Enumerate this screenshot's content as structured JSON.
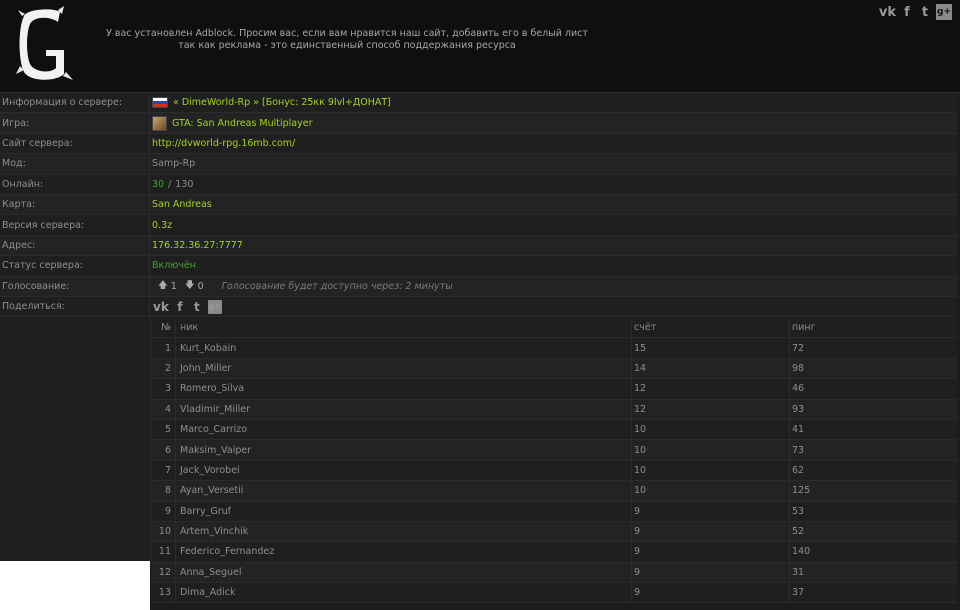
{
  "header": {
    "adblock_line1": "У вас установлен Adblock. Просим вас, если вам нравится наш сайт, добавить его в белый лист",
    "adblock_line2": "так как реклама - это единственный способ поддержания ресурса",
    "social": {
      "vk": "vk",
      "facebook": "f",
      "twitter": "t",
      "googleplus": "g+"
    }
  },
  "server_info": {
    "server_label": "Информация о сервере:",
    "server_name": "« DimeWorld-Rp » [Бонус: 25кк 9lvl+ДОНАТ]",
    "game_label": "Игра:",
    "game_value": "GTA: San Andreas Multiplayer",
    "site_label": "Сайт сервера:",
    "site_value": "http://dvworld-rpg.16mb.com/",
    "mod_label": "Мод:",
    "mod_value": "Samp-Rp",
    "online_label": "Онлайн:",
    "online_current": "30",
    "online_sep": "/",
    "online_max": "130",
    "map_label": "Карта:",
    "map_value": "San Andreas",
    "version_label": "Версия сервера:",
    "version_value": "0.3z",
    "address_label": "Адрес:",
    "address_value": "176.32.36.27:7777",
    "status_label": "Статус сервера:",
    "status_value": "Включён",
    "vote_label": "Голосование:",
    "vote_up": "1",
    "vote_down": "0",
    "vote_note": "Голосование будет доступно через: 2 минуты",
    "share_label": "Поделиться:"
  },
  "players": {
    "headers": {
      "num": "№",
      "nick": "ник",
      "score": "счёт",
      "ping": "пинг"
    },
    "rows": [
      {
        "num": "1",
        "nick": "Kurt_Kobain",
        "score": "15",
        "ping": "72"
      },
      {
        "num": "2",
        "nick": "John_Miller",
        "score": "14",
        "ping": "98"
      },
      {
        "num": "3",
        "nick": "Romero_Silva",
        "score": "12",
        "ping": "46"
      },
      {
        "num": "4",
        "nick": "Vladimir_Miller",
        "score": "12",
        "ping": "93"
      },
      {
        "num": "5",
        "nick": "Marco_Carrizo",
        "score": "10",
        "ping": "41"
      },
      {
        "num": "6",
        "nick": "Maksim_Vaiper",
        "score": "10",
        "ping": "73"
      },
      {
        "num": "7",
        "nick": "Jack_Vorobei",
        "score": "10",
        "ping": "62"
      },
      {
        "num": "8",
        "nick": "Ayan_Versetii",
        "score": "10",
        "ping": "125"
      },
      {
        "num": "9",
        "nick": "Barry_Gruf",
        "score": "9",
        "ping": "53"
      },
      {
        "num": "10",
        "nick": "Artem_Vinchik",
        "score": "9",
        "ping": "52"
      },
      {
        "num": "11",
        "nick": "Federico_Fernandez",
        "score": "9",
        "ping": "140"
      },
      {
        "num": "12",
        "nick": "Anna_Seguel",
        "score": "9",
        "ping": "31"
      },
      {
        "num": "13",
        "nick": "Dima_Adick",
        "score": "9",
        "ping": "37"
      }
    ]
  },
  "colors": {
    "accent_green": "#a3d221",
    "status_green": "#47a32c"
  }
}
